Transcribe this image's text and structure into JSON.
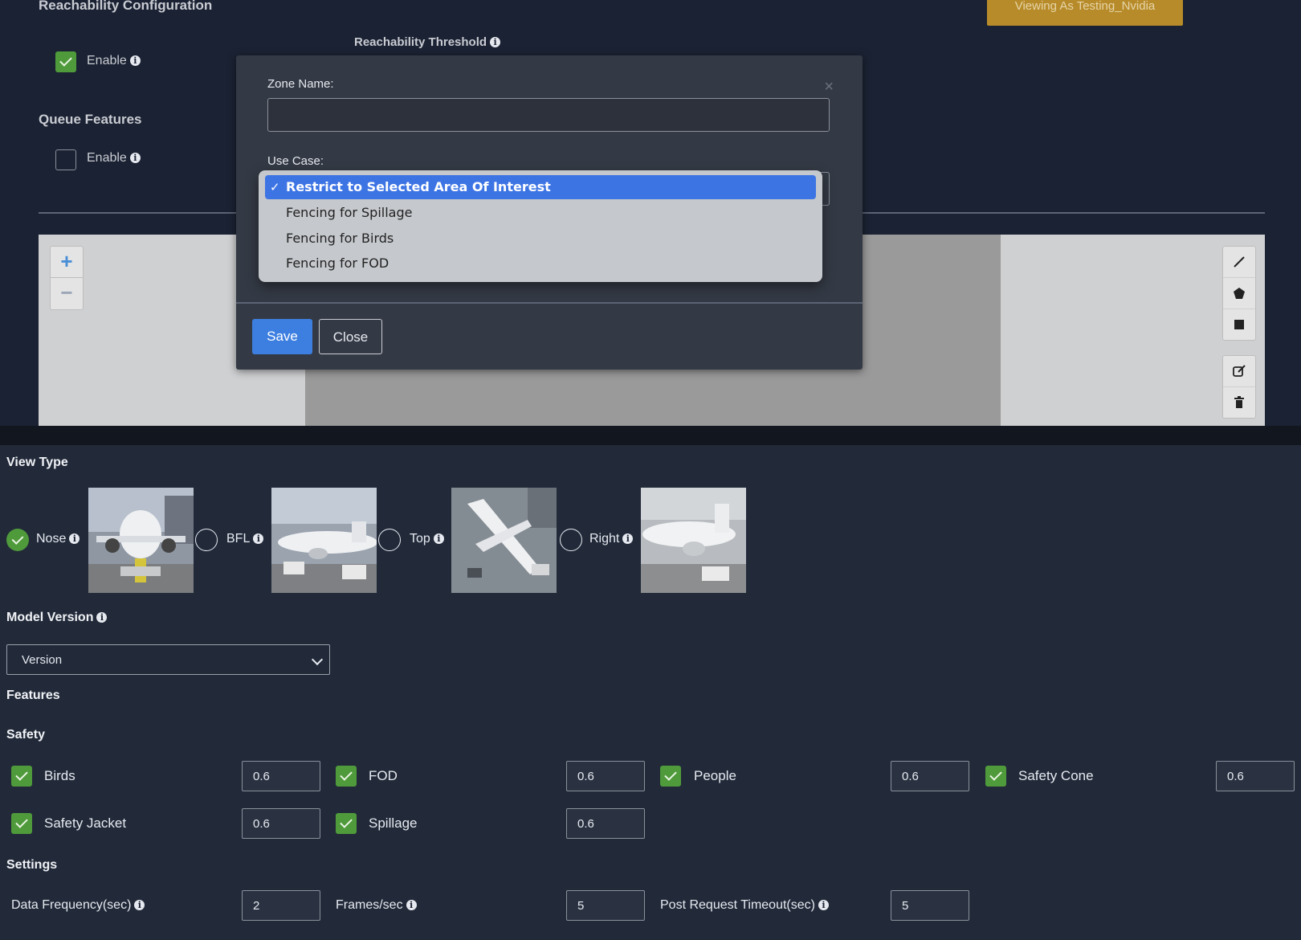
{
  "header": {
    "section_title": "Reachability Configuration",
    "viewing_as": "Viewing As Testing_Nvidia",
    "reachability_threshold_label": "Reachability Threshold",
    "reach_enable_label": "Enable",
    "queue_title": "Queue Features",
    "queue_enable_label": "Enable"
  },
  "map_controls": {
    "zoom_in": "+",
    "zoom_out": "−"
  },
  "modal": {
    "zone_name_label": "Zone Name:",
    "zone_name_value": "",
    "use_case_label": "Use Case:",
    "close_x": "×",
    "options": [
      "Restrict to Selected Area Of Interest",
      "Fencing for Spillage",
      "Fencing for Birds",
      "Fencing for FOD"
    ],
    "selected_index": 0,
    "save_label": "Save",
    "close_label": "Close"
  },
  "view_type": {
    "title": "View Type",
    "options": [
      {
        "label": "Nose",
        "selected": true
      },
      {
        "label": "BFL",
        "selected": false
      },
      {
        "label": "Top",
        "selected": false
      },
      {
        "label": "Right",
        "selected": false
      }
    ]
  },
  "model_version": {
    "title": "Model Version",
    "selected": "Version"
  },
  "features_title": "Features",
  "safety": {
    "title": "Safety",
    "items": [
      {
        "label": "Birds",
        "value": "0.6"
      },
      {
        "label": "FOD",
        "value": "0.6"
      },
      {
        "label": "People",
        "value": "0.6"
      },
      {
        "label": "Safety Cone",
        "value": "0.6"
      },
      {
        "label": "Safety Jacket",
        "value": "0.6"
      },
      {
        "label": "Spillage",
        "value": "0.6"
      }
    ]
  },
  "settings": {
    "title": "Settings",
    "items": [
      {
        "label": "Data Frequency(sec)",
        "value": "2"
      },
      {
        "label": "Frames/sec",
        "value": "5"
      },
      {
        "label": "Post Request Timeout(sec)",
        "value": "5"
      }
    ]
  },
  "colors": {
    "accent_green": "#4f9a3a",
    "primary_blue": "#3d7fe0",
    "badge_gold": "#b88b2a"
  }
}
